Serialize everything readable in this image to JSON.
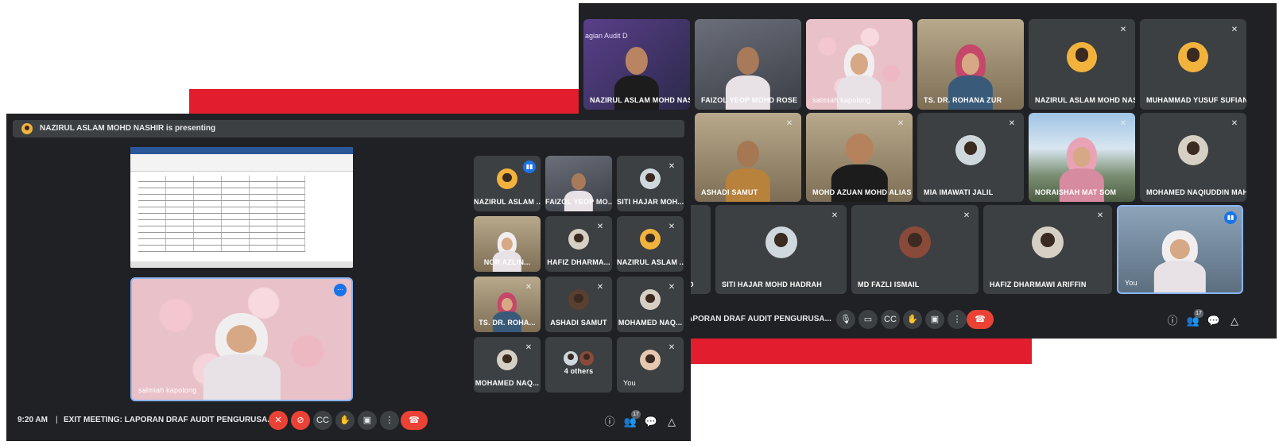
{
  "back_window": {
    "participants": [
      {
        "name": "NAZIRUL ASLAM MOHD NASHIR",
        "banner_text": "agian Audit D"
      },
      {
        "name": "FAIZOL YEOP MOHD ROSE"
      },
      {
        "name": "salmiah kapolong"
      },
      {
        "name": "TS. DR. ROHANA ZUR"
      },
      {
        "name": "NAZIRUL ASLAM MOHD NASHIR"
      },
      {
        "name": "MUHAMMAD YUSUF SUFIAN"
      },
      {
        "name": "ASHADI SAMUT"
      },
      {
        "name": "MOHD AZUAN MOHD ALIAS"
      },
      {
        "name": "MIA IMAWATI JALIL"
      },
      {
        "name": "NORAISHAH MAT SOM"
      },
      {
        "name": "MOHAMED NAQIUDDIN MAHM..."
      },
      {
        "name": "D"
      },
      {
        "name": "SITI HAJAR MOHD HADRAH"
      },
      {
        "name": "MD FAZLI ISMAIL"
      },
      {
        "name": "HAFIZ DHARMAWI ARIFFIN"
      },
      {
        "name": "You"
      }
    ],
    "meeting_title": "LAPORAN DRAF AUDIT PENGURUSA...",
    "people_count": "17"
  },
  "front_window": {
    "presenting_text": "NAZIRUL ASLAM MOHD NASHIR is presenting",
    "featured_name": "salmiah kapolong",
    "grid": [
      {
        "name": "NAZIRUL ASLAM ..."
      },
      {
        "name": "FAIZOL YEOP MO..."
      },
      {
        "name": "SITI HAJAR MOH..."
      },
      {
        "name": "NOR AZLIN..."
      },
      {
        "name": "HAFIZ DHARMA..."
      },
      {
        "name": "NAZIRUL ASLAM ..."
      },
      {
        "name": "TS. DR. ROHA..."
      },
      {
        "name": "ASHADI SAMUT"
      },
      {
        "name": "MOHAMED NAQ..."
      },
      {
        "name": "MOHAMED NAQ..."
      },
      {
        "name": "4 others"
      },
      {
        "name": "You"
      }
    ],
    "time": "9:20 AM",
    "separator": "|",
    "meeting_title": "EXIT MEETING: LAPORAN DRAF AUDIT PENGURUSA...",
    "people_count": "17"
  },
  "colors": {
    "accent_red": "#e11d2e",
    "meet_bg": "#202124",
    "tile_bg": "#3c4043",
    "hangup": "#ea4335",
    "speaking": "#1a73e8"
  },
  "icons": [
    "mic-off-icon",
    "camera-off-icon",
    "captions-icon",
    "raise-hand-icon",
    "present-icon",
    "more-options-icon",
    "hang-up-icon",
    "info-icon",
    "people-icon",
    "chat-icon",
    "activities-icon"
  ]
}
